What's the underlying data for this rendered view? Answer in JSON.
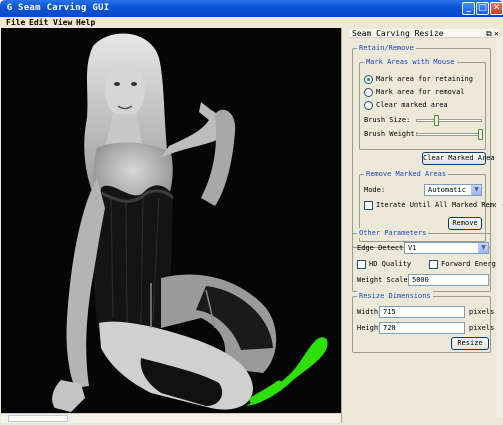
{
  "window": {
    "title": "Seam Carving GUI"
  },
  "menu": {
    "items": [
      "File",
      "Edit",
      "View",
      "Help"
    ]
  },
  "panel": {
    "title": "Seam Carving Resize",
    "retain_remove": {
      "legend": "Retain/Remove",
      "mark_areas": {
        "legend": "Mark Areas with Mouse",
        "options": [
          "Mark area for retaining",
          "Mark area for removal",
          "Clear marked area"
        ],
        "selected_index": 0,
        "brush_size_label": "Brush Size:",
        "brush_size_level": 0.3,
        "brush_weight_label": "Brush Weight:",
        "brush_weight_level": 1.0,
        "clear_button": "Clear Marked Area"
      },
      "remove_marked": {
        "legend": "Remove Marked Areas",
        "mode_label": "Mode:",
        "mode_value": "Automatic",
        "iterate_label": "Iterate Until All Marked Removed",
        "iterate_checked": false,
        "remove_button": "Remove"
      }
    },
    "other_params": {
      "legend": "Other Parameters",
      "edge_detector_label": "Edge Detector:",
      "edge_detector_value": "V1",
      "hd_quality_label": "HD Quality",
      "hd_quality_checked": false,
      "forward_energy_label": "Forward Energy",
      "forward_energy_checked": false,
      "weight_scale_label": "Weight Scale:",
      "weight_scale_value": "5000"
    },
    "resize_dims": {
      "legend": "Resize Dimensions",
      "width_label": "Width:",
      "width_value": "715",
      "width_unit": "pixels",
      "height_label": "Height:",
      "height_value": "720",
      "height_unit": "pixels",
      "resize_button": "Resize"
    }
  },
  "colors": {
    "mark_green": "#2de00a",
    "accent_blue": "#1a45c0"
  }
}
